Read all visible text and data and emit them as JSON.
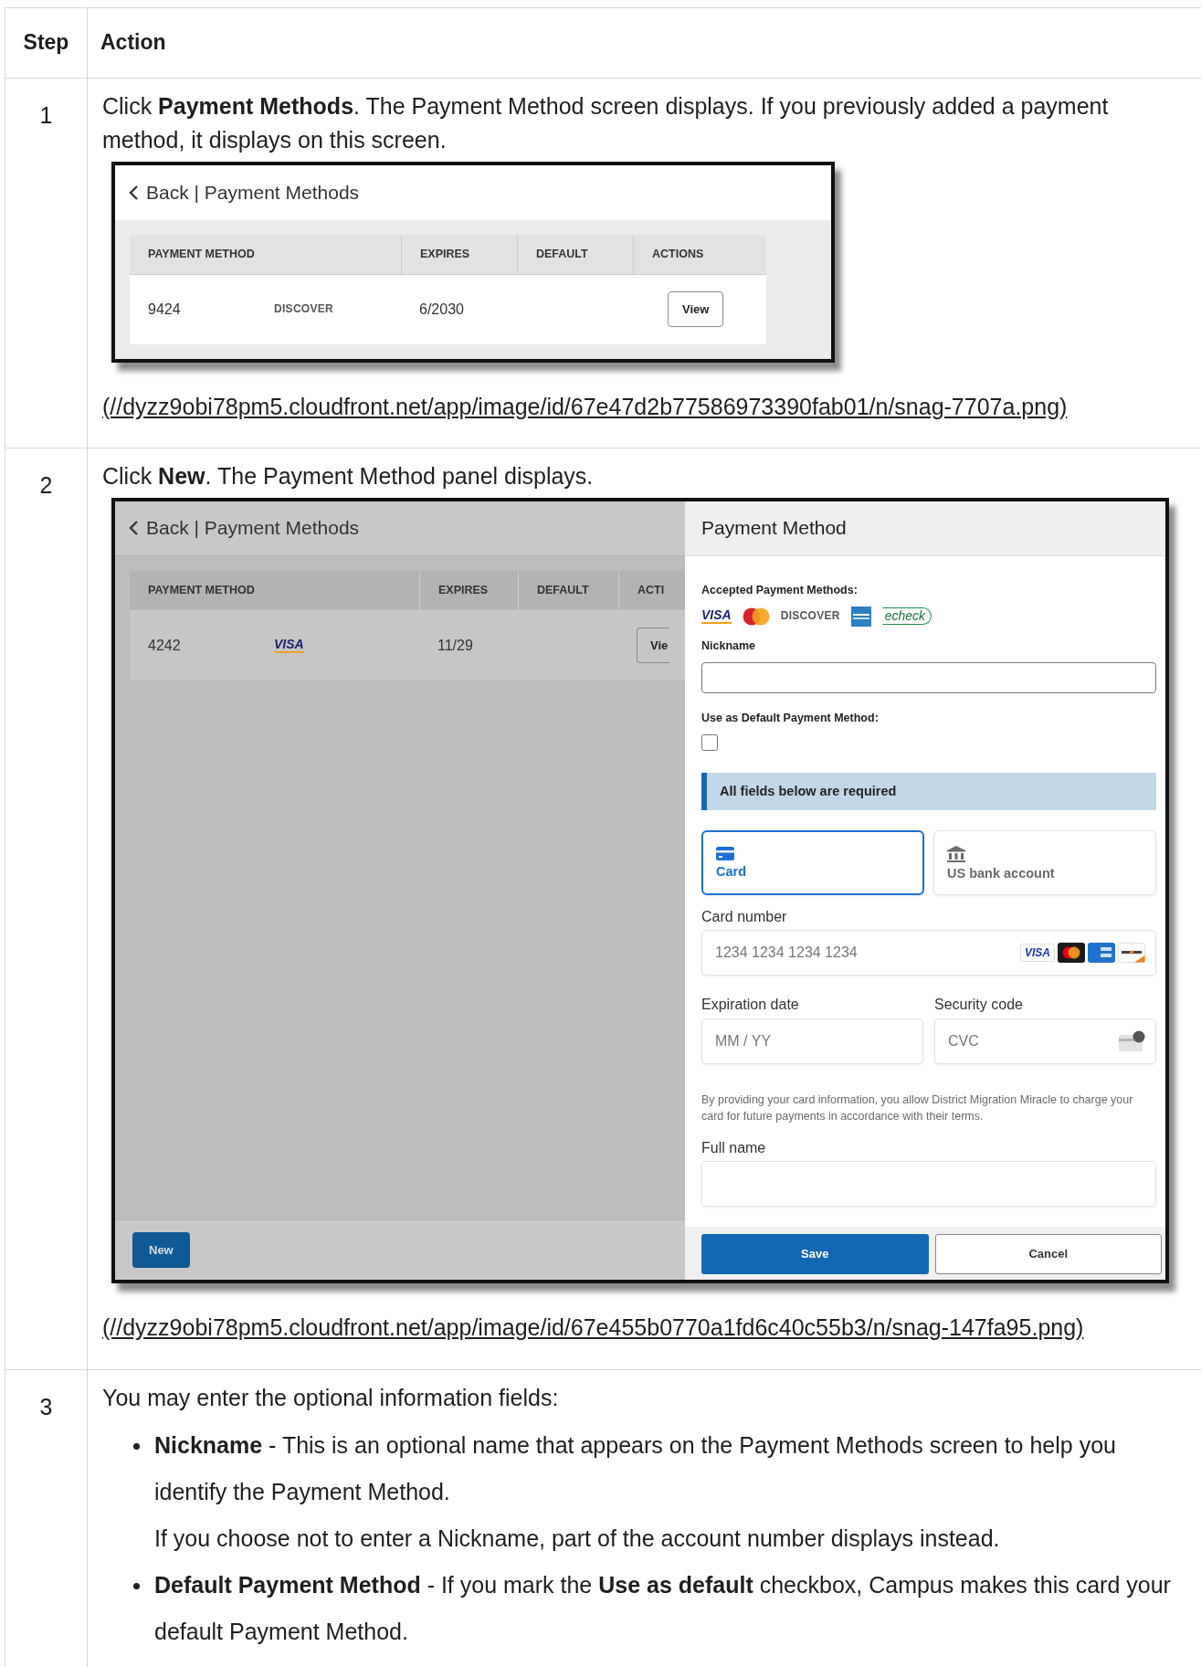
{
  "columns": [
    "Step",
    "Action"
  ],
  "rows": [
    {
      "step": "1",
      "intro": "Click **Payment Methods**. The Payment Method screen displays. If you previously added a payment method, it displays on this screen.",
      "screenshot": {
        "kind": "list",
        "list": {
          "header": "Back | Payment Methods",
          "columns": [
            "PAYMENT METHOD",
            "EXPIRES",
            "DEFAULT",
            "ACTIONS"
          ],
          "rows": [
            {
              "number": "9424",
              "brand": {
                "kind": "discover",
                "text": "DISCOVER"
              },
              "expires": "6/2030",
              "action": "View"
            }
          ]
        }
      },
      "link": "(//dyzz9obi78pm5.cloudfront.net/app/image/id/67e47d2b77586973390fab01/n/snag-7707a.png)"
    },
    {
      "step": "2",
      "intro": "Click **New**. The Payment Method panel displays.",
      "screenshot": {
        "kind": "list_with_panel",
        "list": {
          "header": "Back | Payment Methods",
          "columns": [
            "PAYMENT METHOD",
            "EXPIRES",
            "DEFAULT",
            "ACTI"
          ],
          "rows": [
            {
              "number": "4242",
              "brand": {
                "kind": "visa",
                "text": "VISA"
              },
              "expires": "11/29",
              "action": "Vie"
            }
          ],
          "footer_button": "New"
        },
        "panel": {
          "title": "Payment Method",
          "accepted_label": "Accepted Payment Methods:",
          "accepted": [
            {
              "kind": "visa",
              "text": "VISA"
            },
            {
              "kind": "mastercard"
            },
            {
              "kind": "discover",
              "text": "DISCOVER"
            },
            {
              "kind": "amex"
            },
            {
              "kind": "echeck",
              "text": "echeck"
            }
          ],
          "nickname_label": "Nickname",
          "default_label": "Use as Default Payment Method:",
          "default_checkbox": {
            "checked": false
          },
          "alert": "All fields below are required",
          "tabs": [
            {
              "label": "Card",
              "selected": true
            },
            {
              "label": "US bank account",
              "selected": false
            }
          ],
          "card_number": {
            "label": "Card number",
            "placeholder": "1234 1234 1234 1234",
            "brands": [
              {
                "kind": "visa_tile",
                "text": "VISA"
              },
              {
                "kind": "mastercard_tile"
              },
              {
                "kind": "amex_tile"
              },
              {
                "kind": "discover_tile"
              }
            ]
          },
          "expiration": {
            "label": "Expiration date",
            "placeholder": "MM / YY"
          },
          "security": {
            "label": "Security code",
            "placeholder": "CVC"
          },
          "consent": "By providing your card information, you allow District Migration Miracle to charge your card for future payments in accordance with their terms.",
          "full_name": {
            "label": "Full name"
          },
          "buttons": [
            {
              "kind": "primary",
              "label": "Save"
            },
            {
              "kind": "secondary",
              "label": "Cancel"
            }
          ]
        }
      },
      "link": "(//dyzz9obi78pm5.cloudfront.net/app/image/id/67e455b0770a1fd6c40c55b3/n/snag-147fa95.png)"
    },
    {
      "step": "3",
      "intro": "You may enter the optional information fields:",
      "bullets": [
        {
          "text": "**Nickname** - This is an optional name that appears on the Payment Methods screen to help you identify the Payment Method.",
          "note": "If you choose not to enter a Nickname, part of the account number displays instead."
        },
        {
          "text": "**Default Payment Method** - If you mark the **Use as default** checkbox, Campus makes this card your default Payment Method."
        }
      ]
    }
  ]
}
